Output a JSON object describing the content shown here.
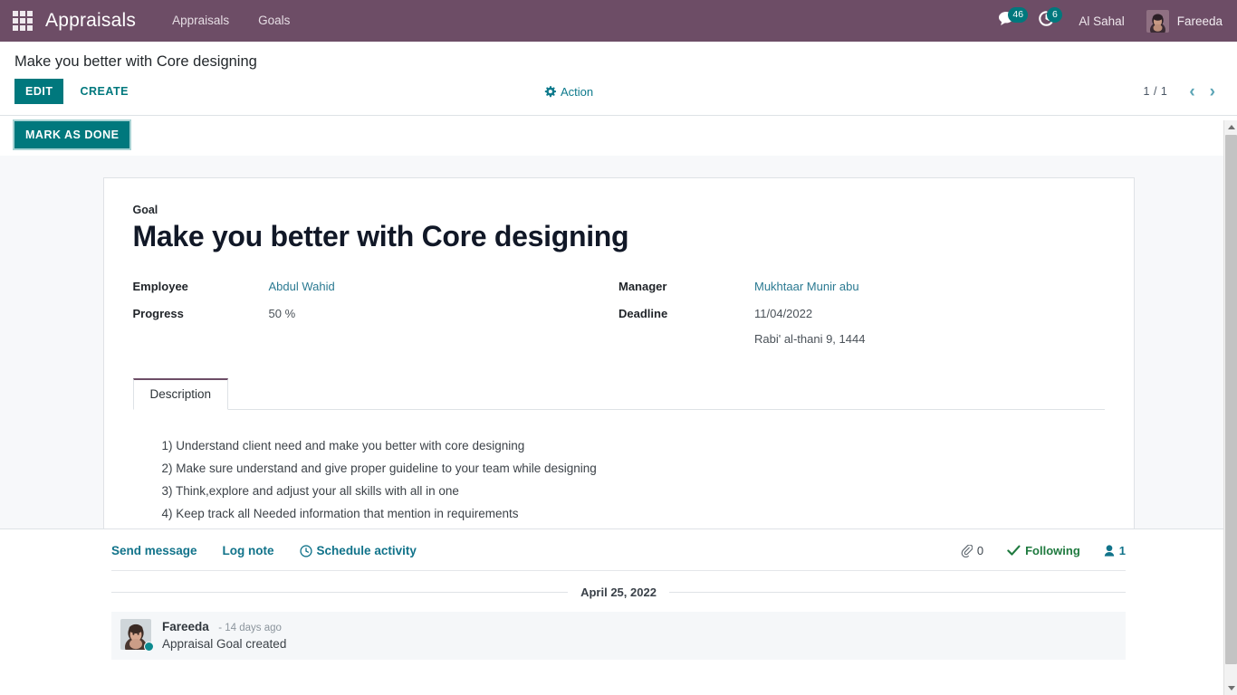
{
  "navbar": {
    "apps_icon": "apps-grid-icon",
    "brand": "Appraisals",
    "menu": [
      {
        "label": "Appraisals"
      },
      {
        "label": "Goals"
      }
    ],
    "messages": {
      "icon": "chat-icon",
      "count": "46"
    },
    "activities": {
      "icon": "clock-icon",
      "count": "6"
    },
    "company": "Al Sahal",
    "user": {
      "name": "Fareeda",
      "avatar_icon": "user-avatar"
    }
  },
  "control_panel": {
    "breadcrumb": "Make you better with Core designing",
    "edit_label": "EDIT",
    "create_label": "CREATE",
    "action_label": "Action",
    "action_icon": "gear-icon",
    "pager": {
      "count": "1 / 1",
      "prev_icon": "chevron-left-icon",
      "next_icon": "chevron-right-icon"
    }
  },
  "statusbar": {
    "mark_as_done_label": "MARK AS DONE"
  },
  "record": {
    "type_label": "Goal",
    "title": "Make you better with Core designing",
    "fields_left": [
      {
        "label": "Employee",
        "value": "Abdul Wahid",
        "is_link": true
      },
      {
        "label": "Progress",
        "value": "50 %",
        "is_link": false
      }
    ],
    "fields_right": [
      {
        "label": "Manager",
        "value": "Mukhtaar Munir abu",
        "is_link": true
      },
      {
        "label": "Deadline",
        "value": "11/04/2022",
        "sub_value": "Rabi' al-thani 9, 1444",
        "is_link": false
      }
    ]
  },
  "notebook": {
    "tabs": [
      {
        "label": "Description",
        "active": true
      }
    ],
    "description_lines": [
      "1) Understand client need and make you better with core designing",
      "2) Make sure understand and give proper guideline to your team while designing",
      "3) Think,explore and adjust your all skills with all in one",
      "4) Keep track all Needed information that mention in requirements"
    ]
  },
  "chatter": {
    "send_message_label": "Send message",
    "log_note_label": "Log note",
    "schedule_activity_label": "Schedule activity",
    "schedule_activity_icon": "clock-icon",
    "attachments": {
      "icon": "paperclip-icon",
      "count": "0"
    },
    "following": {
      "icon": "check-icon",
      "label": "Following"
    },
    "followers": {
      "icon": "user-icon",
      "count": "1"
    },
    "date_separator": "April 25, 2022",
    "messages": [
      {
        "author": "Fareeda",
        "time": "- 14 days ago",
        "body": "Appraisal Goal created",
        "avatar_icon": "user-avatar"
      }
    ]
  },
  "scrollbar": {
    "up_icon": "triangle-up-icon",
    "down_icon": "triangle-down-icon"
  },
  "colors": {
    "navbar": "#6d4d66",
    "primary": "#00787d",
    "link": "#2b7a92",
    "following": "#1f7a3f",
    "sheet_bg": "#f7f8fa"
  }
}
